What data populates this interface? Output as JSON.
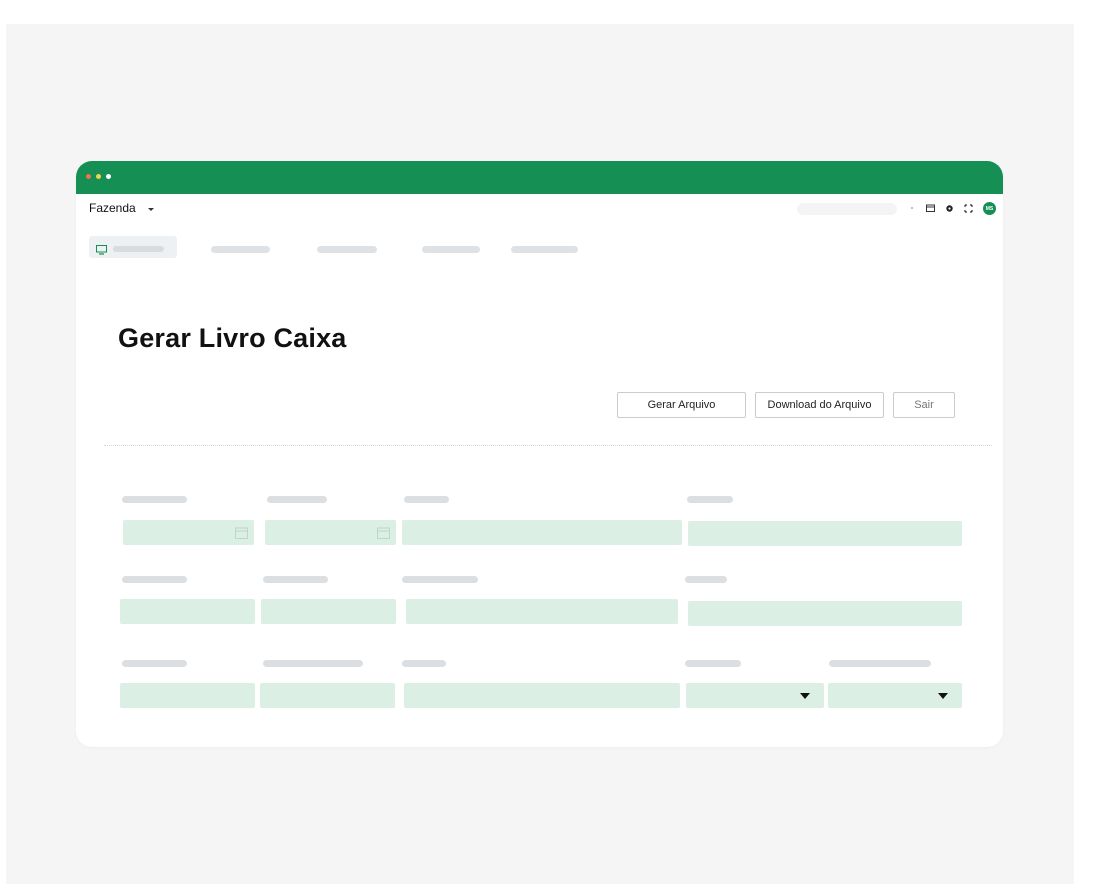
{
  "window": {
    "app_name": "Fazenda",
    "avatar_initials": "MS",
    "accent_color": "#168f55"
  },
  "page": {
    "title": "Gerar Livro Caixa"
  },
  "actions": {
    "generate_label": "Gerar Arquivo",
    "download_label": "Download do Arquivo",
    "exit_label": "Sair"
  },
  "icons": {
    "nav_active": "monitor-icon",
    "date_field": "calendar-icon",
    "select": "caret-down-icon",
    "help": "help-icon",
    "settings": "gear-icon",
    "fullscreen": "expand-icon"
  }
}
